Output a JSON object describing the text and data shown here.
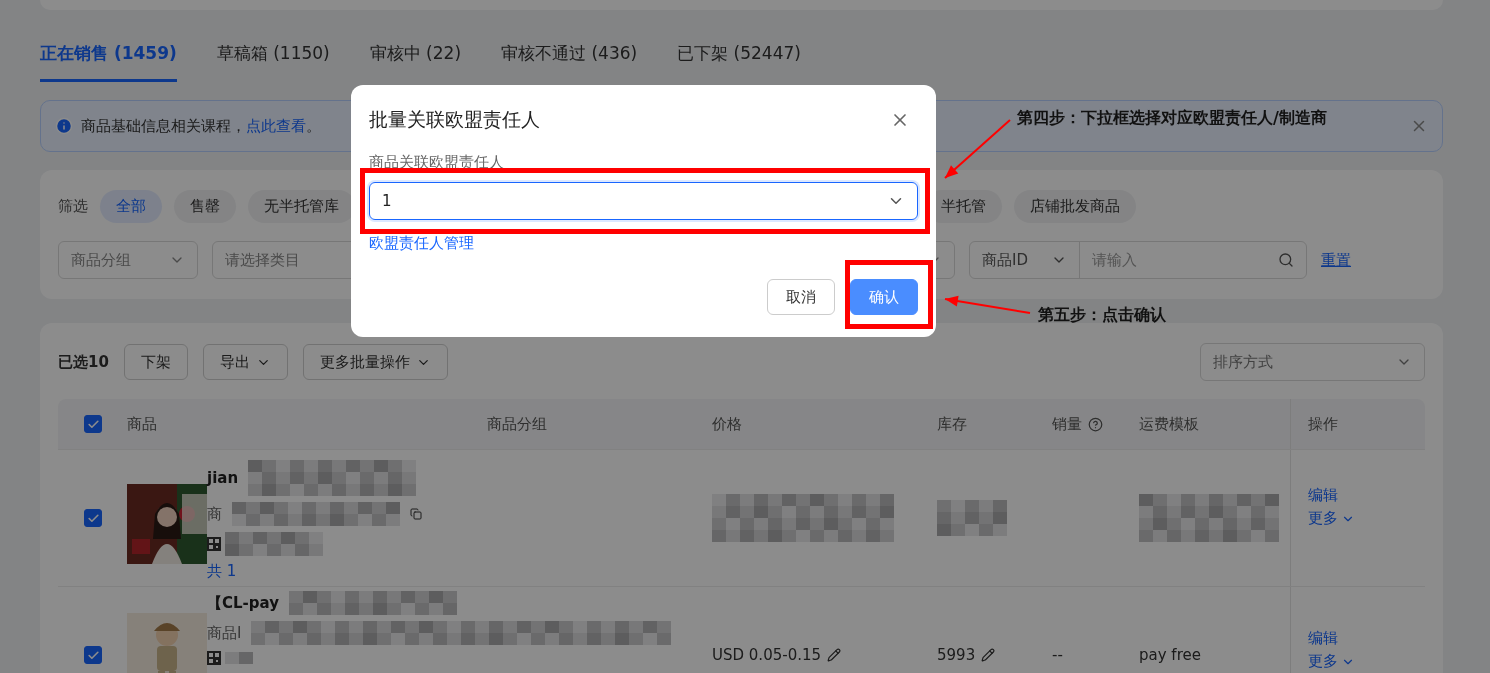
{
  "tabs": [
    {
      "label": "正在销售 (1459)",
      "selected": true
    },
    {
      "label": "草稿箱 (1150)",
      "selected": false
    },
    {
      "label": "审核中 (22)",
      "selected": false
    },
    {
      "label": "审核不通过 (436)",
      "selected": false
    },
    {
      "label": "已下架 (52447)",
      "selected": false
    }
  ],
  "notice": {
    "text": "商品基础信息相关课程，",
    "link": "点此查看",
    "end": "。"
  },
  "filter": {
    "label": "筛选",
    "chips": [
      {
        "label": "全部",
        "selected": true
      },
      {
        "label": "售罄",
        "selected": false
      },
      {
        "label": "无半托管库",
        "selected": false
      },
      {
        "label": "半托管",
        "selected": false
      },
      {
        "label": "店铺批发商品",
        "selected": false
      }
    ],
    "fields": [
      {
        "kind": "select",
        "placeholder": "商品分组"
      },
      {
        "kind": "input",
        "placeholder": "请选择类目"
      },
      {
        "kind": "select"
      },
      {
        "kind": "search",
        "select": "商品ID",
        "placeholder": "请输入"
      }
    ],
    "reset": "重置"
  },
  "toolbar": {
    "selected_count": "已选10",
    "buttons": [
      {
        "label": "下架",
        "dropdown": false
      },
      {
        "label": "导出",
        "dropdown": true
      },
      {
        "label": "更多批量操作",
        "dropdown": true
      }
    ],
    "sort": {
      "placeholder": "排序方式"
    }
  },
  "table": {
    "all_checked": true,
    "columns": [
      {
        "label": "商品",
        "help": false
      },
      {
        "label": "商品分组",
        "help": false
      },
      {
        "label": "价格",
        "help": false
      },
      {
        "label": "库存",
        "help": false
      },
      {
        "label": "销量",
        "help": true
      },
      {
        "label": "运费模板",
        "help": false
      },
      {
        "label": "操作",
        "help": false
      }
    ],
    "rows": [
      {
        "checked": true,
        "title": "jian",
        "id_text": "商",
        "count_link": "共 1",
        "price": "",
        "stock": "",
        "sales": "",
        "shipping": "",
        "actions": [
          "编辑",
          "更多"
        ]
      },
      {
        "checked": true,
        "title": "【CL-pay",
        "id_text": "商品I",
        "count_link": "",
        "price": "USD 0.05-0.15",
        "stock": "5993",
        "sales": "--",
        "shipping": "pay free",
        "actions": [
          "编辑",
          "更多"
        ]
      }
    ]
  },
  "modal": {
    "title": "批量关联欧盟责任人",
    "field_label": "商品关联欧盟责任人",
    "value": "1",
    "link": "欧盟责任人管理",
    "cancel": "取消",
    "confirm": "确认"
  },
  "annotations": [
    {
      "kind": "select",
      "text": "第四步：下拉框选择对应欧盟责任人/制造商"
    },
    {
      "kind": "confirm",
      "text": "第五步：点击确认"
    }
  ]
}
